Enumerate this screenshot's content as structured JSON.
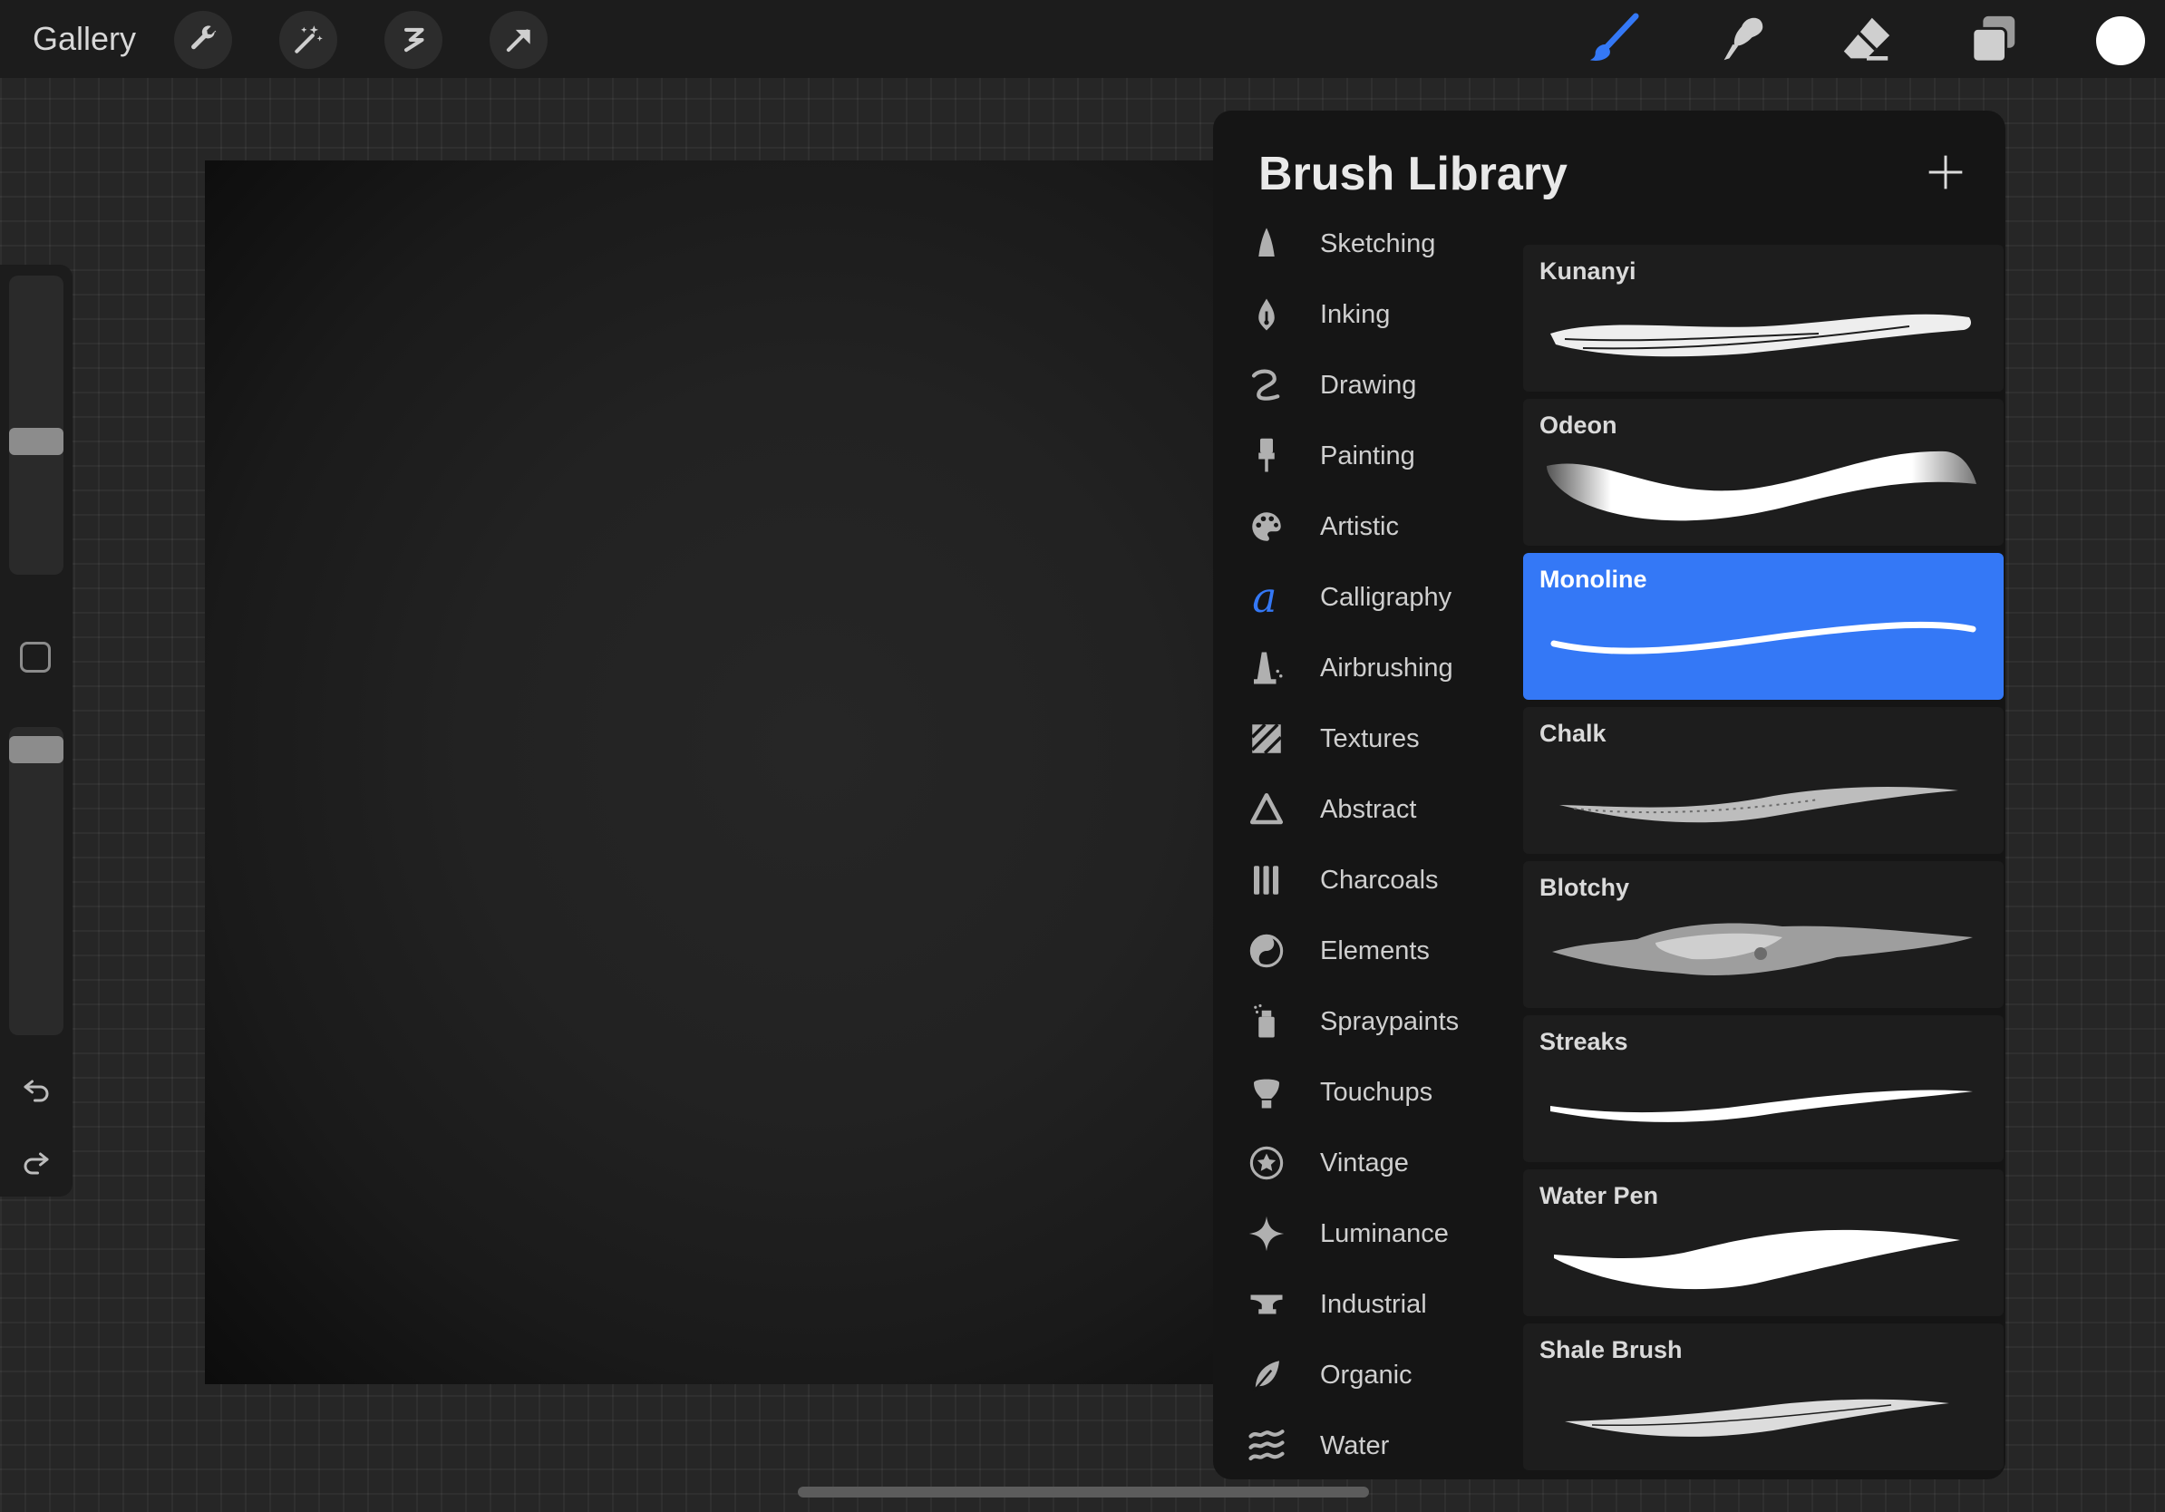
{
  "topbar": {
    "gallery_label": "Gallery",
    "left_tools": [
      "wrench-icon",
      "magic-wand-icon",
      "selection-icon",
      "transform-icon"
    ],
    "right_tools": [
      "brush-icon",
      "smudge-icon",
      "eraser-icon",
      "layers-icon"
    ],
    "active_tool": "brush-icon",
    "accent_color": "#3478f6",
    "current_color": "#ffffff"
  },
  "sidebar": {
    "size_slider_level": 0.55,
    "opacity_slider_level": 0.96
  },
  "brush_library": {
    "title": "Brush Library",
    "categories": [
      {
        "label": "Sketching",
        "icon": "sketching-icon"
      },
      {
        "label": "Inking",
        "icon": "inking-icon"
      },
      {
        "label": "Drawing",
        "icon": "drawing-icon"
      },
      {
        "label": "Painting",
        "icon": "painting-icon"
      },
      {
        "label": "Artistic",
        "icon": "artistic-icon"
      },
      {
        "label": "Calligraphy",
        "icon": "calligraphy-icon",
        "selected": true
      },
      {
        "label": "Airbrushing",
        "icon": "airbrushing-icon"
      },
      {
        "label": "Textures",
        "icon": "textures-icon"
      },
      {
        "label": "Abstract",
        "icon": "abstract-icon"
      },
      {
        "label": "Charcoals",
        "icon": "charcoals-icon"
      },
      {
        "label": "Elements",
        "icon": "elements-icon"
      },
      {
        "label": "Spraypaints",
        "icon": "spraypaints-icon"
      },
      {
        "label": "Touchups",
        "icon": "touchups-icon"
      },
      {
        "label": "Vintage",
        "icon": "vintage-icon"
      },
      {
        "label": "Luminance",
        "icon": "luminance-icon"
      },
      {
        "label": "Industrial",
        "icon": "industrial-icon"
      },
      {
        "label": "Organic",
        "icon": "organic-icon"
      },
      {
        "label": "Water",
        "icon": "water-icon"
      }
    ],
    "brushes": [
      {
        "name": "Kunanyi"
      },
      {
        "name": "Odeon"
      },
      {
        "name": "Monoline",
        "selected": true
      },
      {
        "name": "Chalk"
      },
      {
        "name": "Blotchy"
      },
      {
        "name": "Streaks"
      },
      {
        "name": "Water Pen"
      },
      {
        "name": "Shale Brush"
      }
    ]
  }
}
